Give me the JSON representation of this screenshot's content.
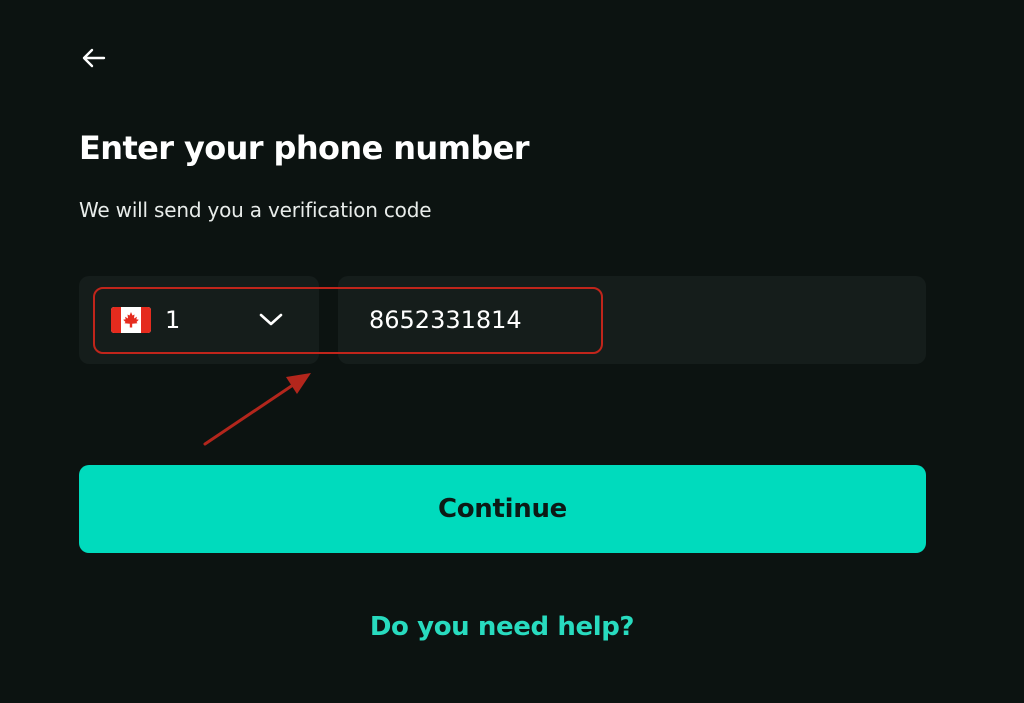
{
  "header": {
    "back_icon": "arrow-left-icon"
  },
  "content": {
    "title": "Enter your phone number",
    "subtitle": "We will send you a verification code"
  },
  "phone_form": {
    "country": {
      "flag_icon": "canada-flag-icon",
      "dial_code": "1",
      "dropdown_icon": "chevron-down-icon"
    },
    "phone_number": "8652331814"
  },
  "actions": {
    "continue_label": "Continue",
    "help_label": "Do you need help?"
  },
  "colors": {
    "background": "#0c1311",
    "field_background": "#151d1b",
    "accent": "#00dbbd",
    "link": "#28dbbf",
    "annotation": "#c0251b"
  }
}
